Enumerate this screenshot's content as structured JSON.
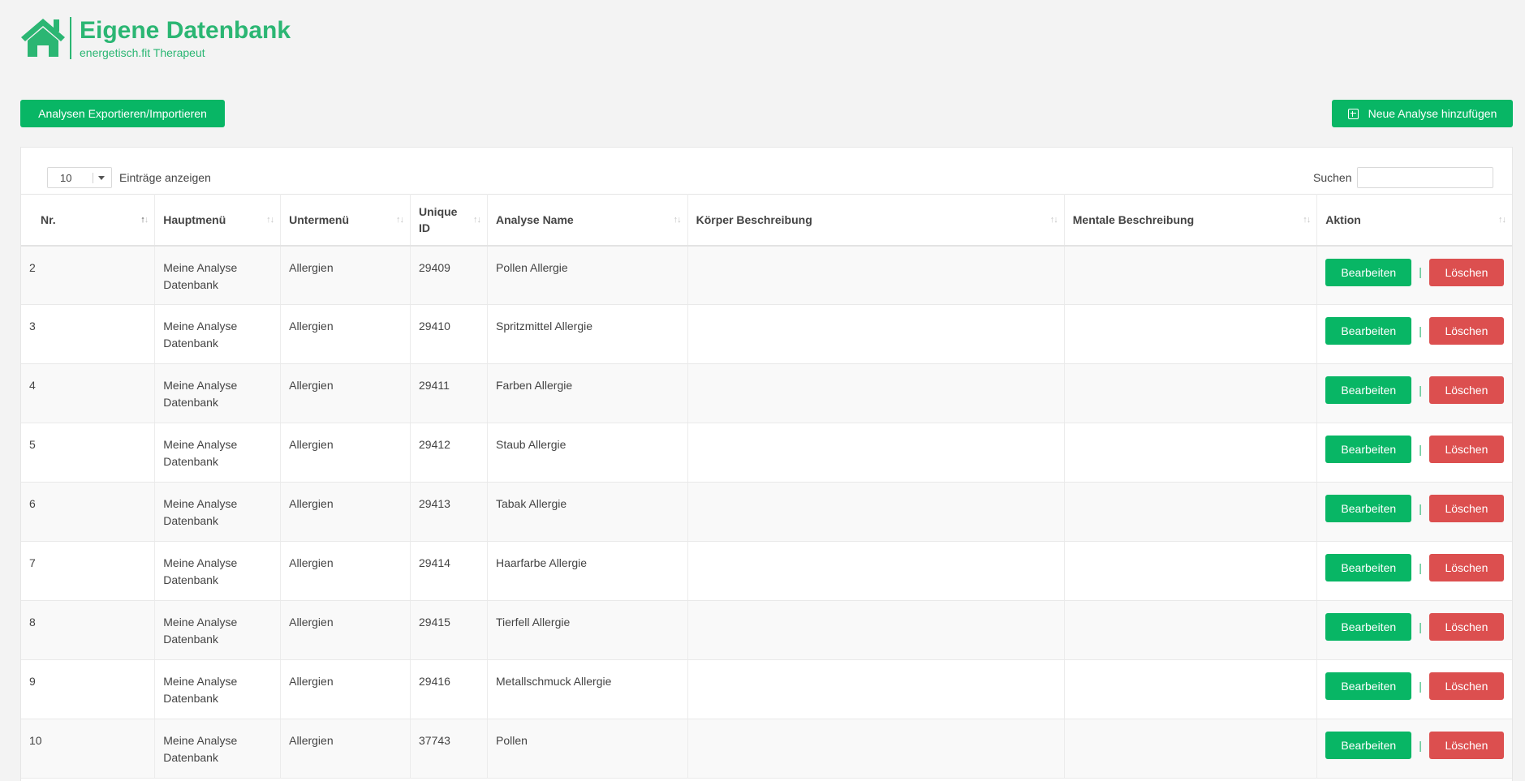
{
  "brand": {
    "title": "Eigene Datenbank",
    "subtitle": "energetisch.fit Therapeut",
    "color": "#2bb673"
  },
  "toolbar": {
    "export_label": "Analysen Exportieren/Importieren",
    "new_label": "Neue Analyse hinzufügen"
  },
  "table_controls": {
    "page_length": "10",
    "page_length_label": "Einträge anzeigen",
    "search_label": "Suchen",
    "search_value": ""
  },
  "columns": [
    {
      "label": "Nr.",
      "sorted": "asc"
    },
    {
      "label": "Hauptmenü",
      "sorted": "none"
    },
    {
      "label": "Untermenü",
      "sorted": "none"
    },
    {
      "label": "Unique ID",
      "sorted": "none"
    },
    {
      "label": "Analyse Name",
      "sorted": "none"
    },
    {
      "label": "Körper Beschreibung",
      "sorted": "none"
    },
    {
      "label": "Mentale Beschreibung",
      "sorted": "none"
    },
    {
      "label": "Aktion",
      "sorted": "none"
    }
  ],
  "rows": [
    {
      "nr": "2",
      "haupt": "Meine Analyse Datenbank",
      "unter": "Allergien",
      "uid": "29409",
      "name": "Pollen Allergie",
      "koerper": "",
      "mental": ""
    },
    {
      "nr": "3",
      "haupt": "Meine Analyse Datenbank",
      "unter": "Allergien",
      "uid": "29410",
      "name": "Spritzmittel Allergie",
      "koerper": "",
      "mental": ""
    },
    {
      "nr": "4",
      "haupt": "Meine Analyse Datenbank",
      "unter": "Allergien",
      "uid": "29411",
      "name": "Farben Allergie",
      "koerper": "",
      "mental": ""
    },
    {
      "nr": "5",
      "haupt": "Meine Analyse Datenbank",
      "unter": "Allergien",
      "uid": "29412",
      "name": "Staub Allergie",
      "koerper": "",
      "mental": ""
    },
    {
      "nr": "6",
      "haupt": "Meine Analyse Datenbank",
      "unter": "Allergien",
      "uid": "29413",
      "name": "Tabak Allergie",
      "koerper": "",
      "mental": ""
    },
    {
      "nr": "7",
      "haupt": "Meine Analyse Datenbank",
      "unter": "Allergien",
      "uid": "29414",
      "name": "Haarfarbe Allergie",
      "koerper": "",
      "mental": ""
    },
    {
      "nr": "8",
      "haupt": "Meine Analyse Datenbank",
      "unter": "Allergien",
      "uid": "29415",
      "name": "Tierfell Allergie",
      "koerper": "",
      "mental": ""
    },
    {
      "nr": "9",
      "haupt": "Meine Analyse Datenbank",
      "unter": "Allergien",
      "uid": "29416",
      "name": "Metallschmuck Allergie",
      "koerper": "",
      "mental": ""
    },
    {
      "nr": "10",
      "haupt": "Meine Analyse Datenbank",
      "unter": "Allergien",
      "uid": "37743",
      "name": "Pollen",
      "koerper": "",
      "mental": ""
    }
  ],
  "row_actions": {
    "edit_label": "Bearbeiten",
    "separator": "|",
    "delete_label": "Löschen"
  },
  "colors": {
    "primary_green": "#08b665",
    "danger_red": "#dc4f4f",
    "page_bg": "#f3f3f3"
  },
  "icons": {
    "logo": "house-icon",
    "new_button": "plus-square-icon",
    "sort": "sort-arrows-icon",
    "select_caret": "caret-down-icon"
  }
}
